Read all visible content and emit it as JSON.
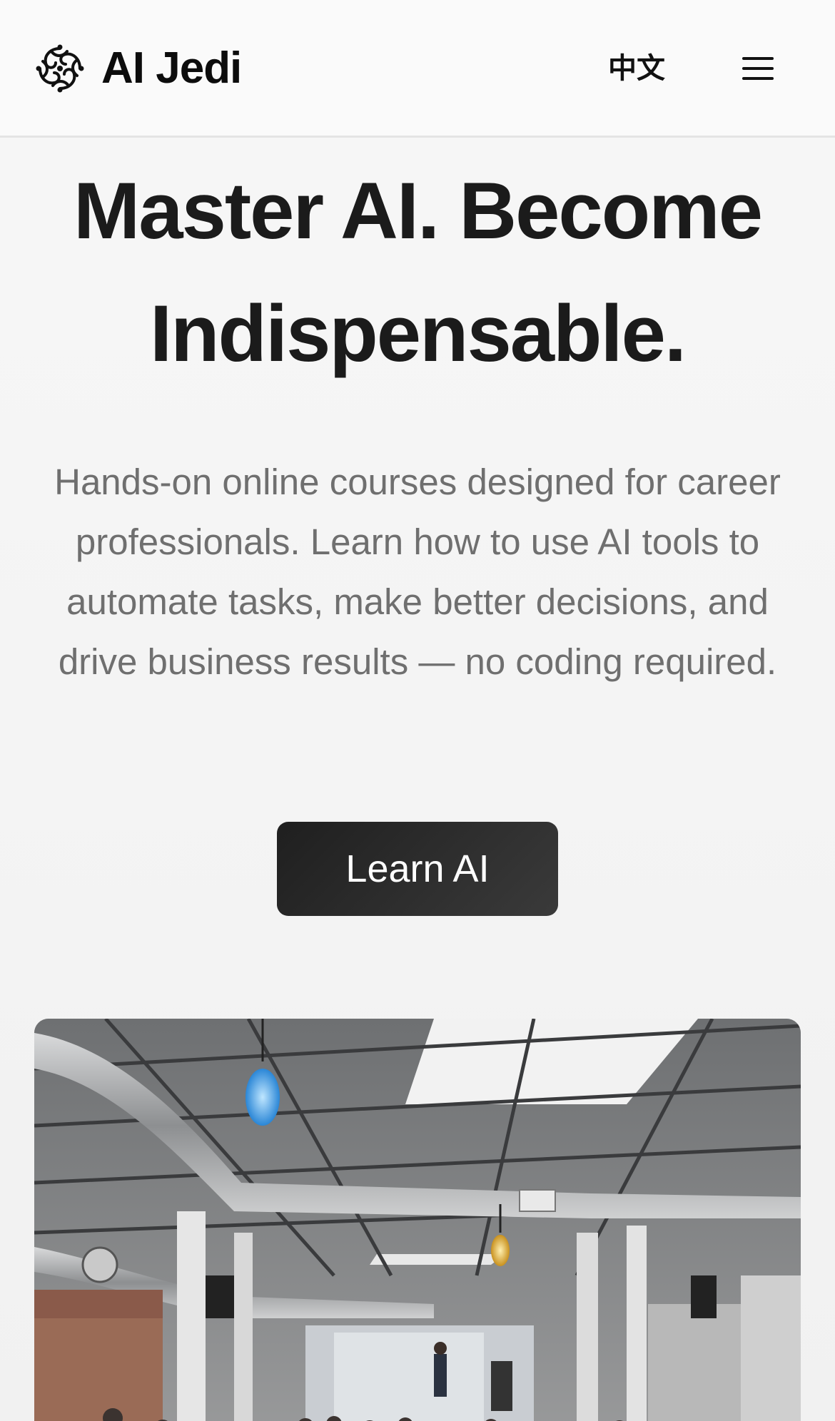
{
  "header": {
    "brand_name": "AI Jedi",
    "logo_icon": "ai-jedi-knot-logo",
    "language_label": "中文",
    "menu_icon": "hamburger-icon"
  },
  "hero": {
    "title": "Master AI. Become Indispensable.",
    "subtitle": "Hands-on online courses designed for career professionals. Learn how to use AI tools to automate tasks, make better decisions, and drive business results — no coding required.",
    "cta_label": "Learn AI"
  },
  "colors": {
    "background": "#f4f4f4",
    "header_background": "#fafafa",
    "title_text": "#1b1b1b",
    "subtitle_text": "#6f6f6f",
    "cta_background": "#2a2a2a",
    "cta_text": "#ffffff"
  }
}
